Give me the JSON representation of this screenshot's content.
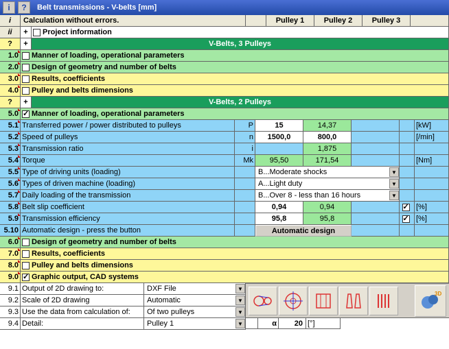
{
  "title": "Belt transmissions - V-belts [mm]",
  "hdr": {
    "status": "Calculation without errors.",
    "p1": "Pulley 1",
    "p2": "Pulley 2",
    "p3": "Pulley 3"
  },
  "ii": {
    "label": "Project information"
  },
  "sect3": "V-Belts, 3 Pulleys",
  "r10": {
    "num": "1.0",
    "label": "Manner of loading, operational parameters"
  },
  "r20": {
    "num": "2.0",
    "label": "Design of geometry and number of belts"
  },
  "r30": {
    "num": "3.0",
    "label": "Results, coefficients"
  },
  "r40": {
    "num": "4.0",
    "label": "Pulley and belts dimensions"
  },
  "sect2": "V-Belts, 2 Pulleys",
  "r50": {
    "num": "5.0",
    "label": "Manner of loading, operational parameters"
  },
  "r51": {
    "num": "5.1",
    "label": "Transferred power / power distributed to pulleys",
    "sym": "P",
    "v1": "15",
    "v2": "14,37",
    "unit": "[kW]"
  },
  "r52": {
    "num": "5.2",
    "label": "Speed of pulleys",
    "sym": "n",
    "v1": "1500,0",
    "v2": "800,0",
    "unit": "[/min]"
  },
  "r53": {
    "num": "5.3",
    "label": "Transmission ratio",
    "sym": "i",
    "v2": "1,875"
  },
  "r54": {
    "num": "5.4",
    "label": "Torque",
    "sym": "Mk",
    "v1": "95,50",
    "v2": "171,54",
    "unit": "[Nm]"
  },
  "r55": {
    "num": "5.5",
    "label": "Type of driving units (loading)",
    "dd": "B...Moderate shocks"
  },
  "r56": {
    "num": "5.6",
    "label": "Types of driven machine (loading)",
    "dd": "A...Light duty"
  },
  "r57": {
    "num": "5.7",
    "label": "Daily loading of the transmission",
    "dd": "B...Over 8 - less than 16 hours"
  },
  "r58": {
    "num": "5.8",
    "label": "Belt slip coefficient",
    "v1": "0,94",
    "v2": "0,94",
    "unit": "[%]"
  },
  "r59": {
    "num": "5.9",
    "label": "Transmission efficiency",
    "v1": "95,8",
    "v2": "95,8",
    "unit": "[%]"
  },
  "r510": {
    "num": "5.10",
    "label": "Automatic design - press the button",
    "btn": "Automatic design"
  },
  "r60": {
    "num": "6.0",
    "label": "Design of geometry and number of belts"
  },
  "r70": {
    "num": "7.0",
    "label": "Results, coefficients"
  },
  "r80": {
    "num": "8.0",
    "label": "Pulley and belts dimensions"
  },
  "r90": {
    "num": "9.0",
    "label": "Graphic output, CAD systems"
  },
  "r91": {
    "num": "9.1",
    "label": "Output of 2D drawing to:",
    "dd": "DXF File"
  },
  "r92": {
    "num": "9.2",
    "label": "Scale of 2D drawing",
    "dd": "Automatic"
  },
  "r93": {
    "num": "9.3",
    "label": "Use the data from calculation of:",
    "dd": "Of two pulleys"
  },
  "r94": {
    "num": "9.4",
    "label": "Detail:",
    "dd": "Pulley 1"
  },
  "alpha": {
    "sym": "α",
    "val": "20",
    "unit": "[°]"
  }
}
